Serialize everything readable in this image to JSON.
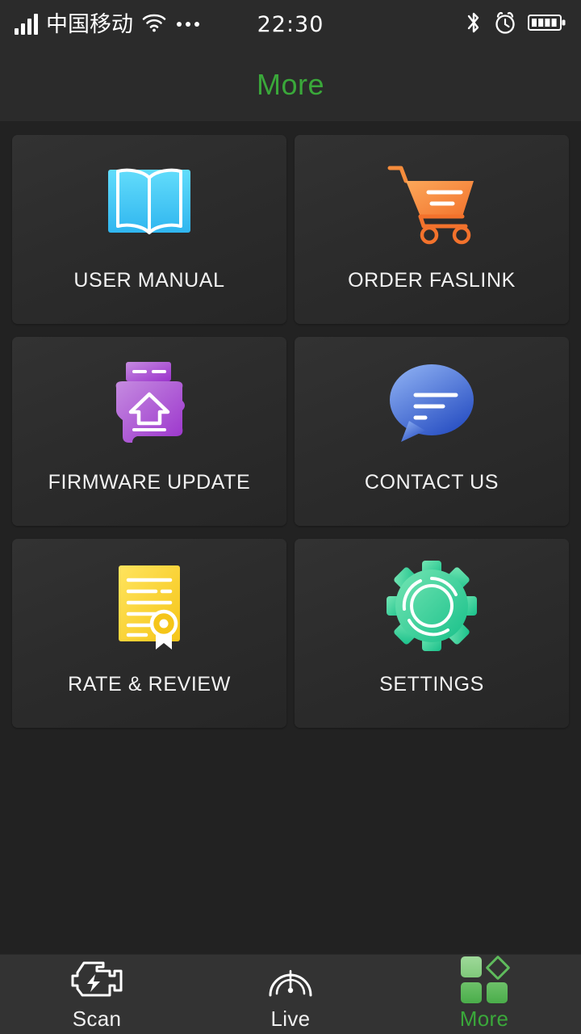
{
  "status_bar": {
    "carrier": "中国移动",
    "time": "22:30",
    "signal_icon": "signal-bars-icon",
    "wifi_icon": "wifi-icon",
    "more_dots_icon": "ellipsis-icon",
    "bluetooth_icon": "bluetooth-icon",
    "alarm_icon": "alarm-clock-icon",
    "battery_icon": "battery-full-icon"
  },
  "header": {
    "title": "More",
    "accent_color": "#3aa83a"
  },
  "grid": {
    "items": [
      {
        "label": "USER MANUAL",
        "icon": "open-book-icon",
        "color": "#4ed2f7"
      },
      {
        "label": "ORDER FASLINK",
        "icon": "shopping-cart-icon",
        "color": "#f5873d"
      },
      {
        "label": "FIRMWARE UPDATE",
        "icon": "firmware-upload-icon",
        "color": "#a855d6"
      },
      {
        "label": "CONTACT US",
        "icon": "chat-bubble-icon",
        "color": "#4f7ee8"
      },
      {
        "label": "RATE & REVIEW",
        "icon": "certificate-icon",
        "color": "#f5d632"
      },
      {
        "label": "SETTINGS",
        "icon": "gear-icon",
        "color": "#34cf9a"
      }
    ]
  },
  "tabbar": {
    "tabs": [
      {
        "label": "Scan",
        "icon": "engine-icon",
        "active": false
      },
      {
        "label": "Live",
        "icon": "speedometer-icon",
        "active": false
      },
      {
        "label": "More",
        "icon": "grid-more-icon",
        "active": true
      }
    ],
    "active_color": "#3aa83a",
    "inactive_color": "#f0f0f0"
  }
}
